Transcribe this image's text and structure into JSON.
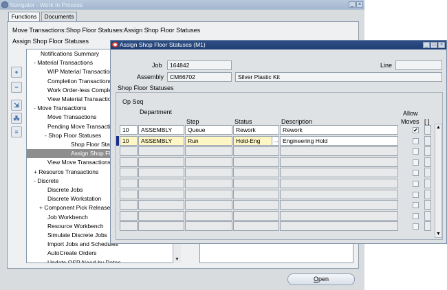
{
  "navigator": {
    "title": "Navigator - Work In Process",
    "tabs": [
      "Functions",
      "Documents"
    ],
    "path": "Move Transactions:Shop Floor Statuses:Assign Shop Floor Statuses",
    "subtitle": "Assign Shop Floor Statuses",
    "tree": [
      {
        "label": "Notifications Summary",
        "indent": 10,
        "selected": false
      },
      {
        "label": "- Material Transactions",
        "indent": 0,
        "selected": false
      },
      {
        "label": "WIP Material Transactions",
        "indent": 20,
        "selected": false
      },
      {
        "label": "Completion Transactions",
        "indent": 20,
        "selected": false
      },
      {
        "label": "Work Order-less Completion",
        "indent": 20,
        "selected": false
      },
      {
        "label": "View Material Transactions",
        "indent": 20,
        "selected": false
      },
      {
        "label": "- Move Transactions",
        "indent": 0,
        "selected": false
      },
      {
        "label": "Move Transactions",
        "indent": 20,
        "selected": false
      },
      {
        "label": "Pending Move Transactions",
        "indent": 20,
        "selected": false
      },
      {
        "label": "- Shop Floor Statuses",
        "indent": 16,
        "selected": false
      },
      {
        "label": "Shop Floor Statuses",
        "indent": 54,
        "selected": false
      },
      {
        "label": "Assign Shop Floor Statuses",
        "indent": 54,
        "selected": true
      },
      {
        "label": "View Move Transactions",
        "indent": 20,
        "selected": false
      },
      {
        "label": "+ Resource Transactions",
        "indent": 0,
        "selected": false
      },
      {
        "label": "- Discrete",
        "indent": 0,
        "selected": false
      },
      {
        "label": "Discrete Jobs",
        "indent": 20,
        "selected": false
      },
      {
        "label": "Discrete Workstation",
        "indent": 20,
        "selected": false
      },
      {
        "label": "+ Component Pick Release",
        "indent": 8,
        "selected": false
      },
      {
        "label": "Job Workbench",
        "indent": 20,
        "selected": false
      },
      {
        "label": "Resource Workbench",
        "indent": 20,
        "selected": false
      },
      {
        "label": "Simulate Discrete Jobs",
        "indent": 20,
        "selected": false
      },
      {
        "label": "Import Jobs and Schedules",
        "indent": 20,
        "selected": false
      },
      {
        "label": "AutoCreate Orders",
        "indent": 20,
        "selected": false
      },
      {
        "label": "Update OSP Need-by Dates",
        "indent": 20,
        "selected": false
      }
    ],
    "side_buttons": [
      "+",
      "−",
      "⁺⁺",
      "⁺⁺",
      "≡"
    ],
    "open_label": "Open",
    "open_mnemonic": "O",
    "open_rest": "pen"
  },
  "dialog": {
    "title": "Assign Shop Floor Statuses (M1)",
    "job_label": "Job",
    "job_value": "164842",
    "line_label": "Line",
    "line_value": "",
    "assembly_label": "Assembly",
    "assembly_value": "CM66702",
    "assembly_desc": "Silver Plastic Kit",
    "section_label": "Shop Floor Statuses",
    "columns": {
      "op_seq": "Op Seq",
      "department": "Department",
      "step": "Step",
      "status": "Status",
      "description": "Description",
      "allow_moves_1": "Allow",
      "allow_moves_2": "Moves",
      "extra": "[ ]"
    },
    "rows": [
      {
        "op_seq": "10",
        "department": "ASSEMBLY",
        "step": "Queue",
        "status": "Rework",
        "description": "Rework",
        "allow_moves": true,
        "current": false
      },
      {
        "op_seq": "10",
        "department": "ASSEMBLY",
        "step": "Run",
        "status": "Hold-Eng",
        "description": "Engineering Hold",
        "allow_moves": false,
        "current": true
      }
    ],
    "empty_rows": 8
  },
  "colors": {
    "current_row": "#fff6c6",
    "title_bar": "#2e4f86",
    "indicator": "#1a2f8a"
  }
}
